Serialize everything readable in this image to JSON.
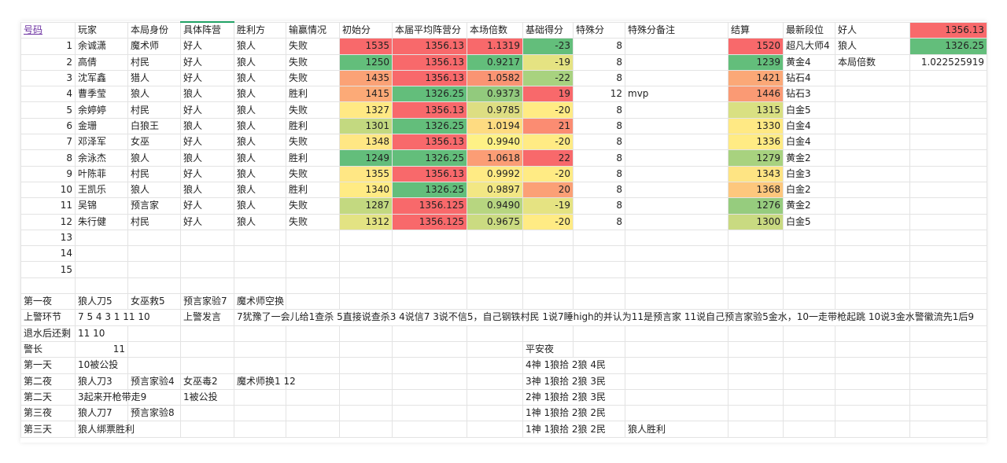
{
  "colors": {
    "red": "#f8696b",
    "green": "#63be7b",
    "accent_link": "#6b2fa0",
    "selection": "#21a366"
  },
  "headers": [
    "号码",
    "玩家",
    "本局身份",
    "具体阵营",
    "胜利方",
    "输赢情况",
    "初始分",
    "本届平均阵营分",
    "本场倍数",
    "基础得分",
    "特殊分",
    "特殊分备注",
    "结算",
    "最新段位"
  ],
  "side_panel": {
    "rows": [
      {
        "label": "好人",
        "value": "1356.13"
      },
      {
        "label": "狼人",
        "value": "1326.25"
      },
      {
        "label": "本局倍数",
        "value": "1.022525919"
      }
    ]
  },
  "players": [
    {
      "no": "1",
      "name": "余诚潇",
      "role": "魔术师",
      "camp": "好人",
      "winner": "狼人",
      "result": "失败",
      "init": "1535",
      "avg": "1356.13",
      "mult": "1.1319",
      "base": "-23",
      "special": "8",
      "note": "",
      "settle": "1520",
      "rank": "超凡大师4"
    },
    {
      "no": "2",
      "name": "高倩",
      "role": "村民",
      "camp": "好人",
      "winner": "狼人",
      "result": "失败",
      "init": "1250",
      "avg": "1356.13",
      "mult": "0.9217",
      "base": "-19",
      "special": "8",
      "note": "",
      "settle": "1239",
      "rank": "黄金4"
    },
    {
      "no": "3",
      "name": "沈军鑫",
      "role": "猎人",
      "camp": "好人",
      "winner": "狼人",
      "result": "失败",
      "init": "1435",
      "avg": "1356.13",
      "mult": "1.0582",
      "base": "-22",
      "special": "8",
      "note": "",
      "settle": "1421",
      "rank": "钻石4"
    },
    {
      "no": "4",
      "name": "曹季莹",
      "role": "狼人",
      "camp": "狼人",
      "winner": "狼人",
      "result": "胜利",
      "init": "1415",
      "avg": "1326.25",
      "mult": "0.9373",
      "base": "19",
      "special": "12",
      "note": "mvp",
      "settle": "1446",
      "rank": "钻石3"
    },
    {
      "no": "5",
      "name": "余婷婷",
      "role": "村民",
      "camp": "好人",
      "winner": "狼人",
      "result": "失败",
      "init": "1327",
      "avg": "1356.13",
      "mult": "0.9785",
      "base": "-20",
      "special": "8",
      "note": "",
      "settle": "1315",
      "rank": "白金5"
    },
    {
      "no": "6",
      "name": "金珊",
      "role": "白狼王",
      "camp": "狼人",
      "winner": "狼人",
      "result": "胜利",
      "init": "1301",
      "avg": "1326.25",
      "mult": "1.0194",
      "base": "21",
      "special": "8",
      "note": "",
      "settle": "1330",
      "rank": "白金4"
    },
    {
      "no": "7",
      "name": "邓泽军",
      "role": "女巫",
      "camp": "好人",
      "winner": "狼人",
      "result": "失败",
      "init": "1348",
      "avg": "1356.13",
      "mult": "0.9940",
      "base": "-20",
      "special": "8",
      "note": "",
      "settle": "1336",
      "rank": "白金4"
    },
    {
      "no": "8",
      "name": "余泳杰",
      "role": "狼人",
      "camp": "狼人",
      "winner": "狼人",
      "result": "胜利",
      "init": "1249",
      "avg": "1326.25",
      "mult": "1.0618",
      "base": "22",
      "special": "8",
      "note": "",
      "settle": "1279",
      "rank": "黄金2"
    },
    {
      "no": "9",
      "name": "叶陈菲",
      "role": "村民",
      "camp": "好人",
      "winner": "狼人",
      "result": "失败",
      "init": "1355",
      "avg": "1356.13",
      "mult": "0.9992",
      "base": "-20",
      "special": "8",
      "note": "",
      "settle": "1343",
      "rank": "白金3"
    },
    {
      "no": "10",
      "name": "王凯乐",
      "role": "狼人",
      "camp": "狼人",
      "winner": "狼人",
      "result": "胜利",
      "init": "1340",
      "avg": "1326.25",
      "mult": "0.9897",
      "base": "20",
      "special": "8",
      "note": "",
      "settle": "1368",
      "rank": "白金2"
    },
    {
      "no": "11",
      "name": "吴锦",
      "role": "预言家",
      "camp": "好人",
      "winner": "狼人",
      "result": "失败",
      "init": "1287",
      "avg": "1356.125",
      "mult": "0.9490",
      "base": "-19",
      "special": "8",
      "note": "",
      "settle": "1276",
      "rank": "黄金2"
    },
    {
      "no": "12",
      "name": "朱行健",
      "role": "村民",
      "camp": "好人",
      "winner": "狼人",
      "result": "失败",
      "init": "1312",
      "avg": "1356.125",
      "mult": "0.9675",
      "base": "-20",
      "special": "8",
      "note": "",
      "settle": "1300",
      "rank": "白金5"
    }
  ],
  "empty_numbers": [
    "13",
    "14",
    "15"
  ],
  "colorscale": {
    "init": [
      "#f8696b",
      "#63be7b",
      "#fba276",
      "#fcaa77",
      "#ffe984",
      "#c3d980",
      "#ffe784",
      "#63be7b",
      "#ffe784",
      "#ffeb84",
      "#c3d980",
      "#e3e383"
    ],
    "avg": [
      "#f8696b",
      "#f8696b",
      "#f8696b",
      "#63be7b",
      "#f8696b",
      "#63be7b",
      "#f8696b",
      "#63be7b",
      "#f8696b",
      "#63be7b",
      "#f8696b",
      "#f8696b"
    ],
    "mult": [
      "#f8696b",
      "#63be7b",
      "#fa9473",
      "#92ca7d",
      "#ddde82",
      "#fedb81",
      "#fef186",
      "#fb9d75",
      "#ffeb84",
      "#f2e784",
      "#b7d680",
      "#cbdb81"
    ],
    "base": [
      "#63be7b",
      "#e5e382",
      "#a8d27f",
      "#f8696b",
      "#ffeb84",
      "#fb8c72",
      "#ffeb84",
      "#f8696b",
      "#ffeb84",
      "#fba076",
      "#e5e382",
      "#ffeb84"
    ],
    "settle": [
      "#f8696b",
      "#63be7b",
      "#fba877",
      "#fa9a74",
      "#d9e082",
      "#ffe984",
      "#ffeb84",
      "#a8d27f",
      "#fee483",
      "#fdc77d",
      "#96cc7e",
      "#c9da81"
    ]
  },
  "log": [
    {
      "label": "第一夜",
      "cells": [
        "狼人刀5",
        "女巫救5",
        "预言家验7",
        "魔术师空换"
      ]
    },
    {
      "label": "上警环节",
      "cells": [
        "7 5 4 3 1 11 10",
        "",
        "上警发言",
        "7犹豫了一会儿给1查杀 5直接说查杀3  4说信7 3说不信5，自己钢铁村民 1说7睡high的并认为11是预言家 11说自己预言家验5金水，10一走带枪起跳 10说3金水警徽流先1后9"
      ]
    },
    {
      "label": "退水后还剩",
      "cells": [
        "11 10"
      ]
    },
    {
      "label": "警长",
      "cells": [
        "11"
      ]
    },
    {
      "label": "第一天",
      "cells": [
        "10被公投"
      ]
    },
    {
      "label": "第二夜",
      "cells": [
        "狼人刀3",
        "预言家验4",
        "女巫毒2",
        "魔术师换1 12"
      ]
    },
    {
      "label": "第二天",
      "cells": [
        "3起来开枪带走9",
        "",
        "1被公投"
      ]
    },
    {
      "label": "第三夜",
      "cells": [
        "狼人刀7",
        "预言家验8"
      ]
    },
    {
      "label": "第三天",
      "cells": [
        "狼人绑票胜利"
      ]
    }
  ],
  "safe_night": {
    "title": "平安夜",
    "rows": [
      "4神 1狼拾 2狼 4民",
      "3神 1狼拾 2狼 3民",
      "2神 1狼拾 2狼 3民",
      "1神 1狼拾 2狼 2民",
      "1神 1狼拾 2狼 2民"
    ],
    "final": "狼人胜利"
  }
}
